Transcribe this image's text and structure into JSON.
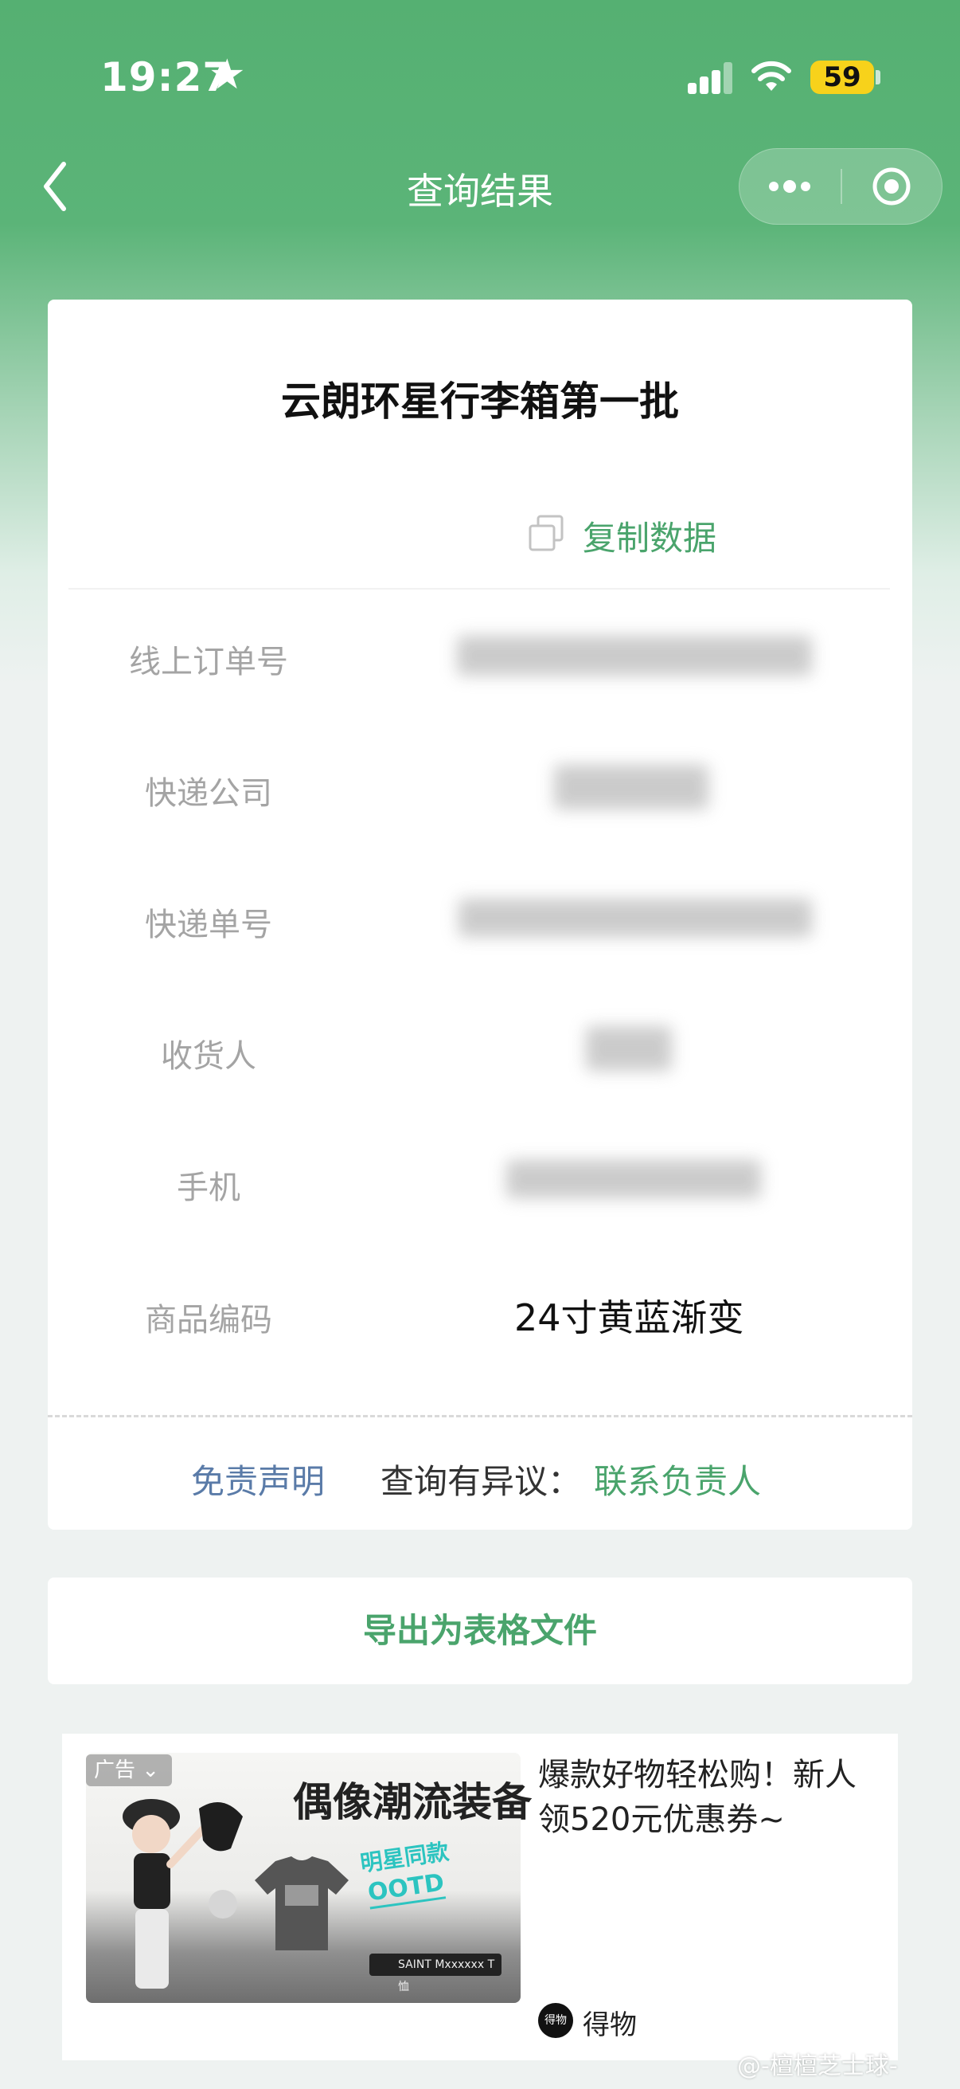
{
  "status_bar": {
    "time": "19:27",
    "battery": "59"
  },
  "nav": {
    "title": "查询结果"
  },
  "card": {
    "title": "云朗环星行李箱第一批",
    "copy_label": "复制数据",
    "rows": [
      {
        "label": "线上订单号"
      },
      {
        "label": "快递公司"
      },
      {
        "label": "快递单号"
      },
      {
        "label": "收货人"
      },
      {
        "label": "手机"
      },
      {
        "label": "商品编码",
        "value": "24寸黄蓝渐变"
      }
    ],
    "footer": {
      "disclaimer": "免责声明",
      "query_label": "查询有异议：",
      "contact": "联系负责人"
    }
  },
  "export_button": "导出为表格文件",
  "ad": {
    "tag": "广告",
    "headline": "偶像潮流装备",
    "stamp_line1": "明星同款",
    "stamp_line2": "OOTD",
    "search_text": "SAINT Mxxxxxx T恤",
    "text": "爆款好物轻松购！新人领520元优惠券~",
    "logo_text": "得物",
    "brand": "得物"
  },
  "watermark": "@-檀檀芝士球-",
  "colors": {
    "accent_green": "#4aa46c",
    "header_green": "#55b072",
    "link_blue": "#5a7ba8"
  }
}
